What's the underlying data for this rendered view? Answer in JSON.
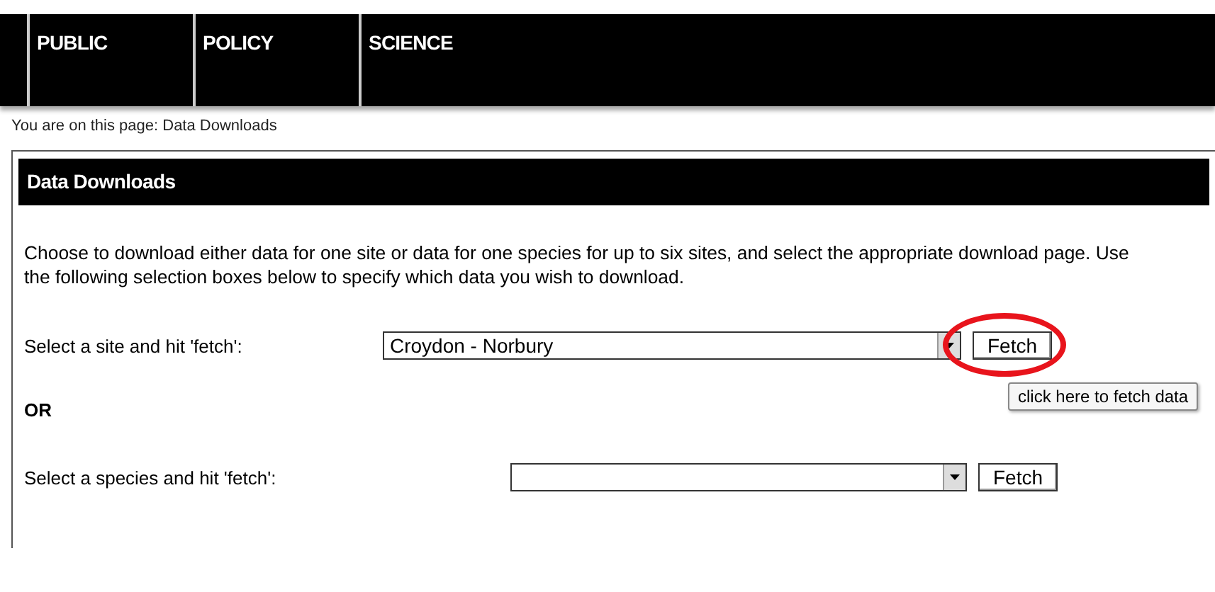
{
  "nav": {
    "items": [
      {
        "label": "PUBLIC"
      },
      {
        "label": "POLICY"
      },
      {
        "label": "SCIENCE"
      }
    ]
  },
  "breadcrumb": "You are on this page: Data Downloads",
  "panel": {
    "title": "Data Downloads",
    "intro": "Choose to download either data for one site or data for one species for up to six sites, and select the appropriate download page. Use the following selection boxes below to specify which data you wish to download.",
    "rows": [
      {
        "kind": "select",
        "label": "Select a site and hit 'fetch':",
        "value": "Croydon - Norbury",
        "button": "Fetch",
        "highlighted": true,
        "tooltip": "click here to fetch data"
      },
      {
        "kind": "separator",
        "label": "OR"
      },
      {
        "kind": "select",
        "label": "Select a species and hit 'fetch':",
        "button": "Fetch"
      }
    ]
  }
}
